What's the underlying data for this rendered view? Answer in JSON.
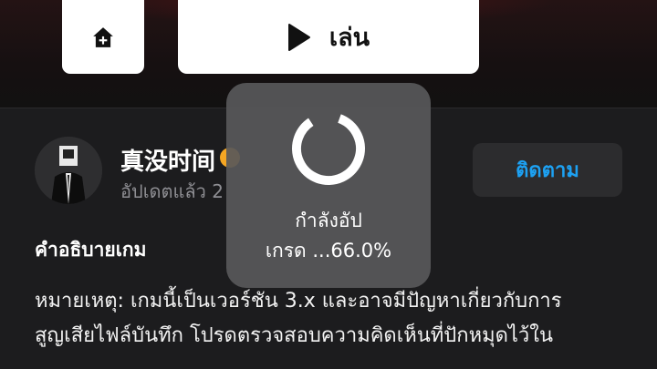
{
  "hero": {
    "add_icon": "home-plus-icon",
    "play_icon": "play-icon",
    "play_label": "เล่น"
  },
  "creator": {
    "name": "真没时间",
    "badge_icon": "verified-badge-icon",
    "updated": "อัปเดตแล้ว 2",
    "follow_label": "ติดตาม"
  },
  "description": {
    "title": "คำอธิบายเกม",
    "lines": [
      "หมายเหตุ: เกมนี้เป็นเวอร์ชัน 3.x และอาจมีปัญหาเกี่ยวกับการ",
      "สูญเสียไฟล์บันทึก โปรดตรวจสอบความคิดเห็นที่ปักหมุดไว้ใน"
    ]
  },
  "loading": {
    "line1": "กำลังอัป",
    "line2": "เกรด ...66.0%",
    "progress_percent": 66.0
  },
  "colors": {
    "accent": "#1da1f2",
    "background": "#1c1c1e",
    "badge": "#f5a623"
  }
}
